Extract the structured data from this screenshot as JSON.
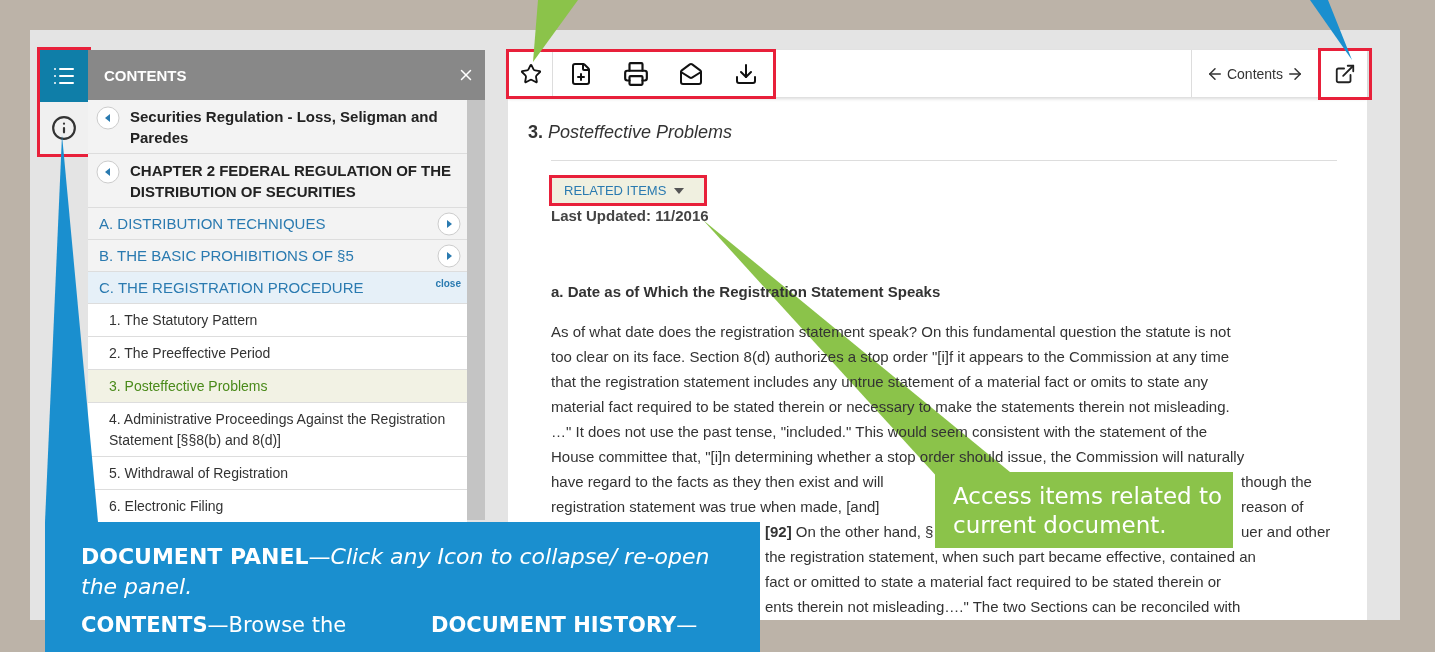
{
  "sidebar_rail": {
    "items": [
      {
        "kind": "contents",
        "selected": true
      },
      {
        "kind": "info",
        "selected": false
      }
    ]
  },
  "contents_panel": {
    "title": "CONTENTS",
    "breadcrumbs": [
      {
        "label": "Securities Regulation - Loss, Seligman and Paredes"
      },
      {
        "label": "CHAPTER 2 FEDERAL REGULATION OF THE DISTRIBUTION OF SECURITIES"
      }
    ],
    "sections": [
      {
        "label": "A. DISTRIBUTION TECHNIQUES",
        "expanded": false
      },
      {
        "label": "B. THE BASIC PROHIBITIONS OF §5",
        "expanded": false
      },
      {
        "label": "C. THE REGISTRATION PROCEDURE",
        "expanded": true,
        "action": "close",
        "children": [
          {
            "label": "1. The Statutory Pattern",
            "selected": false
          },
          {
            "label": "2. The Preeffective Period",
            "selected": false
          },
          {
            "label": "3. Posteffective Problems",
            "selected": true
          },
          {
            "label": "4. Administrative Proceedings Against the Registration Statement [§§8(b) and 8(d)]",
            "selected": false
          },
          {
            "label": "5. Withdrawal of Registration",
            "selected": false
          },
          {
            "label": "6. Electronic Filing",
            "selected": false
          }
        ]
      }
    ]
  },
  "document": {
    "toolbar": {
      "tools": [
        {
          "kind": "star"
        },
        {
          "kind": "add"
        },
        {
          "kind": "print"
        },
        {
          "kind": "email"
        },
        {
          "kind": "download"
        }
      ],
      "nav_label": "Contents"
    },
    "heading_number": "3.",
    "heading": "Posteffective Problems",
    "related_button": "RELATED ITEMS",
    "last_updated": "Last Updated: 11/2016",
    "subheading": "a. Date as of Which the Registration Statement Speaks",
    "paragraph_lines": [
      {
        "kind": "full",
        "segments": [
          "As of what date does the registration statement speak? On this fundamental question the statute is not"
        ]
      },
      {
        "kind": "full",
        "segments": [
          "too clear on its face. Section 8(d) authorizes a stop order \"[i]f it appears to the Commission at any time"
        ]
      },
      {
        "kind": "full",
        "segments": [
          "that the registration statement includes any untrue statement of a material fact or omits to state any"
        ]
      },
      {
        "kind": "full",
        "segments": [
          "material fact required to be stated therein or necessary to make the statements therein not misleading."
        ]
      },
      {
        "kind": "full",
        "segments": [
          "…\" It does not use the past tense, \"included.\" This would seem consistent with the statement of the"
        ]
      },
      {
        "kind": "full",
        "segments": [
          "House committee that, \"[i]n determining whether a stop order should issue, the Commission will naturally"
        ]
      },
      {
        "kind": "split",
        "segments": [
          "have regard to the facts as they then exist and will",
          "though the"
        ]
      },
      {
        "kind": "split",
        "segments": [
          "registration statement was true when made, [and]",
          "reason of"
        ]
      },
      {
        "kind": "indent_split",
        "segments": [
          "**[92]** On the other hand, §",
          "uer and other"
        ]
      },
      {
        "kind": "indent",
        "segments": [
          "the registration statement, when such part became effective, contained an"
        ]
      },
      {
        "kind": "indent",
        "segments": [
          "fact or omitted to state a material fact required to be stated therein or"
        ]
      },
      {
        "kind": "indent",
        "segments": [
          "ents therein not misleading….\" The two Sections can be reconciled with"
        ]
      }
    ]
  },
  "callouts": {
    "panel": {
      "text": "**DOCUMENT PANEL**—*Click any Icon to collapse/ re-open the panel.*",
      "columns": [
        "**CONTENTS**—Browse the",
        "**DOCUMENT HISTORY**—"
      ]
    },
    "related": {
      "text": "Access items related to current document."
    }
  }
}
